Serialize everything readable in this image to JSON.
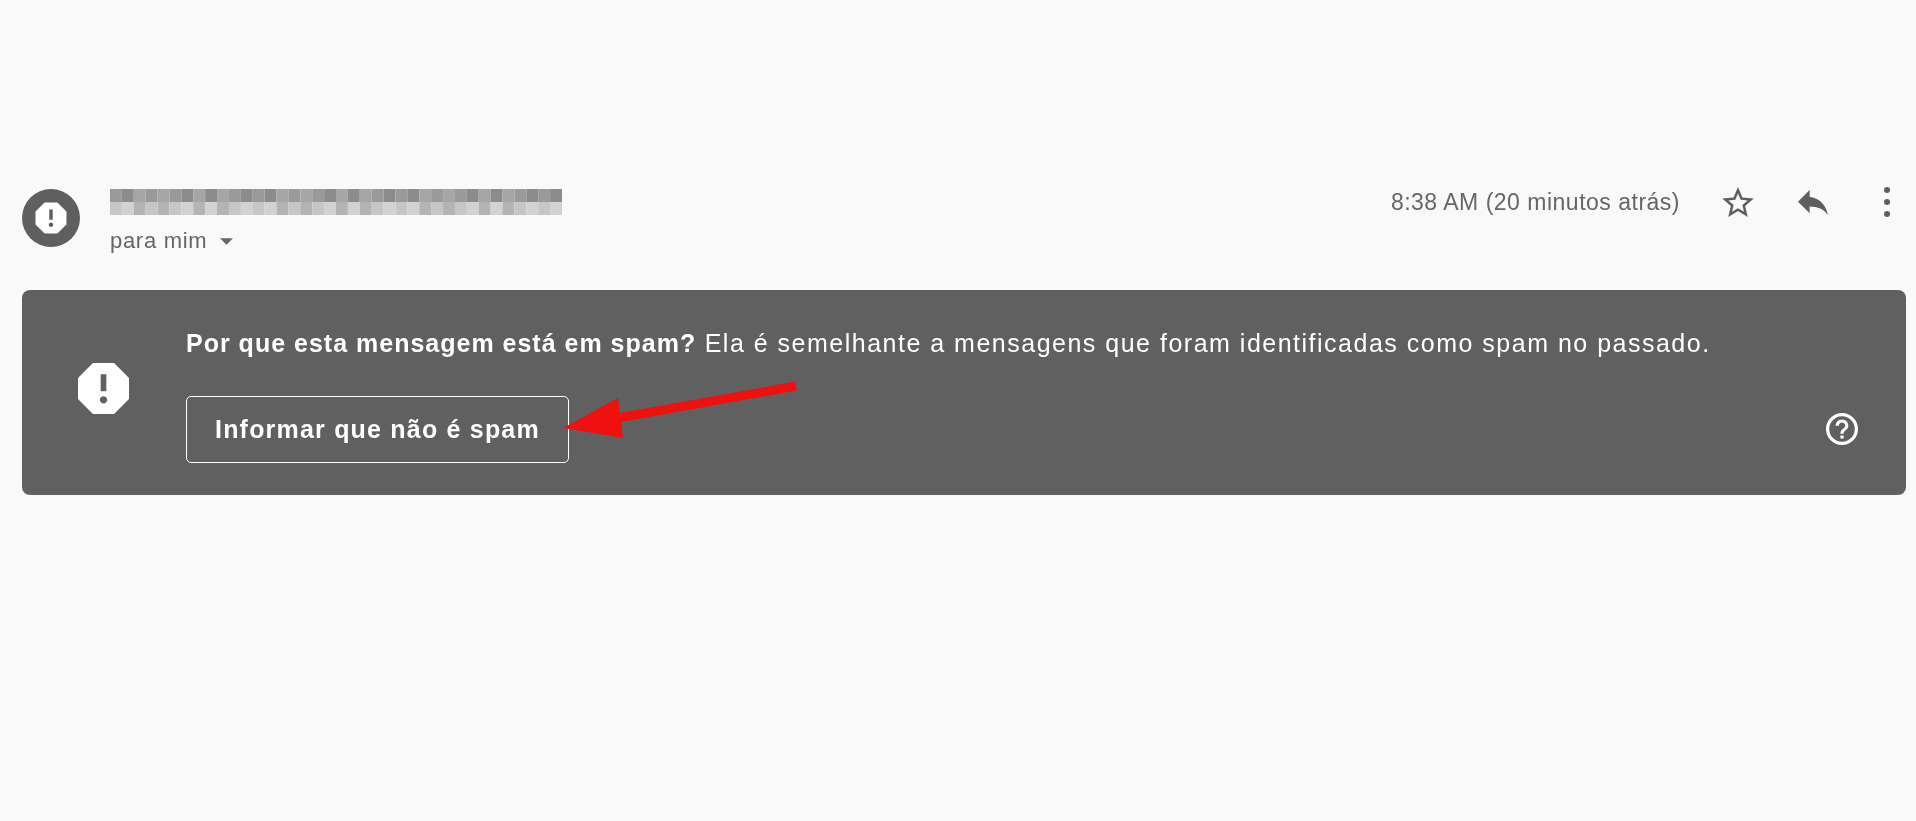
{
  "message_header": {
    "recipient": "para mim",
    "timestamp": "8:38 AM (20 minutos atrás)",
    "starred": false
  },
  "spam_banner": {
    "message": "**Por que esta mensagem está em spam?** Ela é semelhante a mensagens que foram identificadas como spam no passado.",
    "button": "Informar que não é spam"
  }
}
